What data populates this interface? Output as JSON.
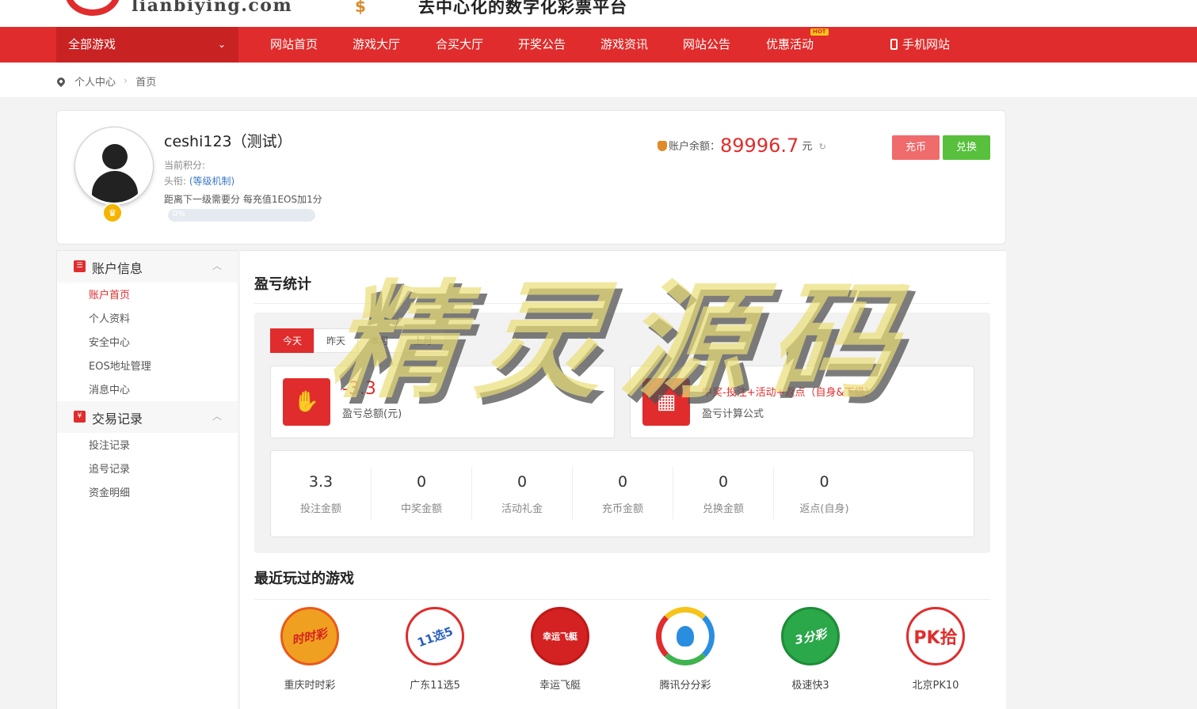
{
  "header": {
    "site_domain": "lianbiying.com",
    "logo_mark": "$",
    "slogan": "去中心化的数字化彩票平台"
  },
  "nav": {
    "all_games": "全部游戏",
    "all_games_chevron": "⌄",
    "items": [
      "网站首页",
      "游戏大厅",
      "合买大厅",
      "开奖公告",
      "游戏资讯",
      "网站公告",
      "优惠活动"
    ],
    "hot_badge": "HOT",
    "mobile": "手机网站"
  },
  "breadcrumb": {
    "items": [
      "个人中心",
      "首页"
    ],
    "separator": "›"
  },
  "profile": {
    "username": "ceshi123（测试）",
    "points_label": "当前积分:",
    "title_label": "头衔:",
    "title_link": "(等级机制)",
    "next_level_text": "距离下一级需要分 每充值1EOS加1分",
    "level_percent": "0%",
    "level_progress": 0,
    "balance_label": "账户余额：",
    "balance_amount": "89996.7",
    "balance_unit": "元",
    "refresh_icon": "↻",
    "charge_button": "充币",
    "exchange_button": "兑换"
  },
  "sidebar": {
    "groups": [
      {
        "title": "账户信息",
        "icon": "list-icon",
        "items": [
          "账户首页",
          "个人资料",
          "安全中心",
          "EOS地址管理",
          "消息中心"
        ]
      },
      {
        "title": "交易记录",
        "icon": "receipt-icon",
        "items": [
          "投注记录",
          "追号记录",
          "资金明细"
        ]
      }
    ],
    "caret": "︿"
  },
  "stats": {
    "title": "盈亏统计",
    "tabs": [
      "今天",
      "昨天",
      "本月",
      "上月"
    ],
    "active_tab": 0,
    "total_value": "-3.3",
    "total_label": "盈亏总额(元)",
    "formula": "中奖-投注+活动+返点（自身&下级）",
    "formula_label": "盈亏计算公式",
    "numbers": [
      {
        "value": "3.3",
        "label": "投注金额"
      },
      {
        "value": "0",
        "label": "中奖金额"
      },
      {
        "value": "0",
        "label": "活动礼金"
      },
      {
        "value": "0",
        "label": "充币金额"
      },
      {
        "value": "0",
        "label": "兑换金额"
      },
      {
        "value": "0",
        "label": "返点(自身)"
      }
    ]
  },
  "recent": {
    "title": "最近玩过的游戏",
    "games": [
      {
        "name": "重庆时时彩",
        "logo_text": "时时彩",
        "color": "#f0a020"
      },
      {
        "name": "广东11选5",
        "logo_text": "11选5",
        "color": "#ffffff"
      },
      {
        "name": "幸运飞艇",
        "logo_text": "幸运飞艇",
        "color": "#d42222"
      },
      {
        "name": "腾讯分分彩",
        "logo_text": "",
        "color": "#ffffff"
      },
      {
        "name": "极速快3",
        "logo_text": "3分彩",
        "color": "#2aa84a"
      },
      {
        "name": "北京PK10",
        "logo_text": "PK拾",
        "color": "#ffffff"
      }
    ]
  },
  "watermark": "精灵源码",
  "colors": {
    "brand_red": "#e02c2c",
    "exchange_green": "#58c03c",
    "link_blue": "#3a78c8"
  }
}
